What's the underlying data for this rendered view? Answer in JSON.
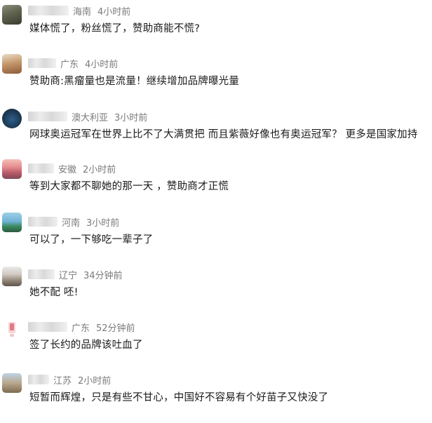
{
  "comments": [
    {
      "region": "海南",
      "time": "4小时前",
      "text": "媒体慌了，粉丝慌了，赞助商能不慌?"
    },
    {
      "region": "广东",
      "time": "4小时前",
      "text": "赞助商:黑瘤量也是流量！继续增加品牌曝光量"
    },
    {
      "region": "澳大利亚",
      "time": "3小时前",
      "text": "网球奥运冠军在世界上比不了大满贯把  而且紫薇好像也有奥运冠军？ 更多是国家加持"
    },
    {
      "region": "安徽",
      "time": "2小时前",
      "text": "等到大家都不聊她的那一天 ，赞助商才正慌"
    },
    {
      "region": "河南",
      "time": "3小时前",
      "text": "可以了，一下够吃一辈子了"
    },
    {
      "region": "辽宁",
      "time": "34分钟前",
      "text": "她不配 呸!"
    },
    {
      "region": "广东",
      "time": "52分钟前",
      "text": "签了长约的品牌该吐血了"
    },
    {
      "region": "江苏",
      "time": "2小时前",
      "text": "短暂而辉煌，只是有些不甘心，中国好不容易有个好苗子又快没了"
    }
  ],
  "colors": {
    "text": "#1a1a1a",
    "meta": "#7a7a7a",
    "background": "#ffffff"
  }
}
